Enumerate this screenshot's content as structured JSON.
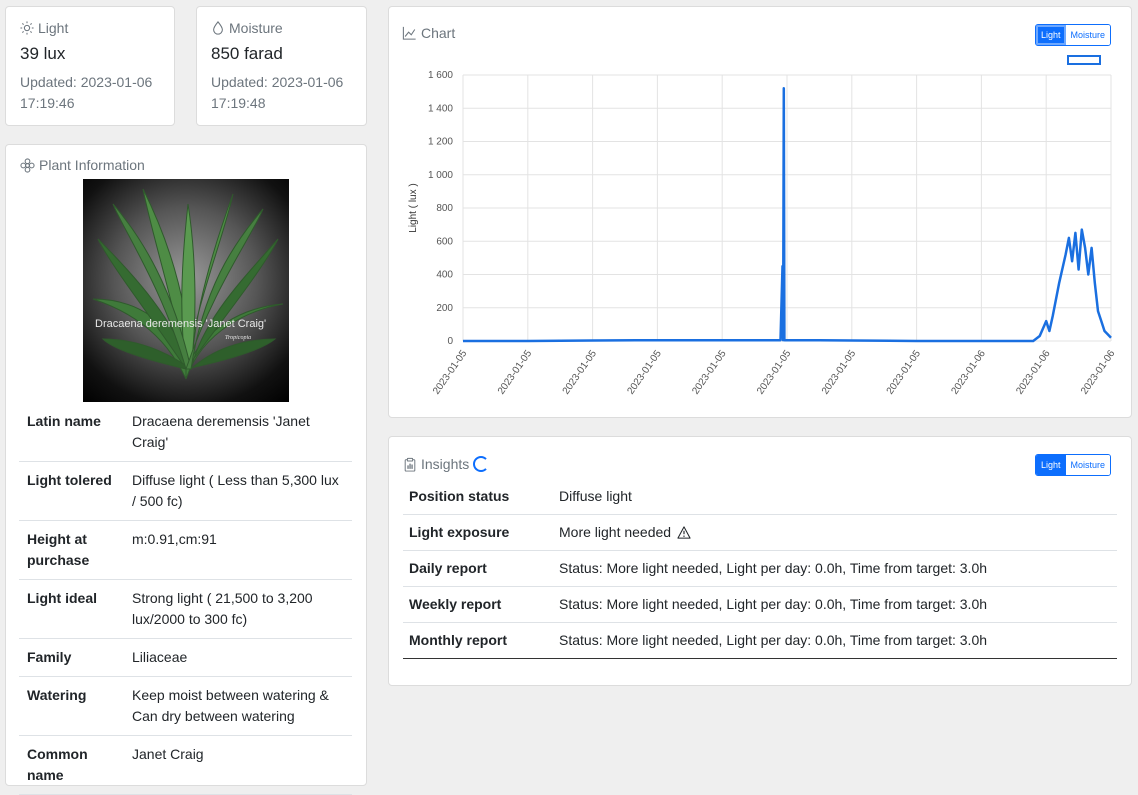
{
  "light_card": {
    "title": "Light",
    "value": "39 lux",
    "updated": "Updated: 2023-01-06 17:19:46"
  },
  "moisture_card": {
    "title": "Moisture",
    "value": "850 farad",
    "updated": "Updated: 2023-01-06 17:19:48"
  },
  "plant": {
    "title": "Plant Information",
    "photo_caption": "Dracaena deremensis 'Janet Craig'",
    "photo_watermark": "Tropicopia",
    "rows": [
      {
        "key": "Latin name",
        "value": "Dracaena deremensis 'Janet Craig'"
      },
      {
        "key": "Light tolered",
        "value": "Diffuse light ( Less than 5,300 lux / 500 fc)"
      },
      {
        "key": "Height at purchase",
        "value": "m:0.91,cm:91"
      },
      {
        "key": "Light ideal",
        "value": "Strong light ( 21,500 to 3,200 lux/2000 to 300 fc)"
      },
      {
        "key": "Family",
        "value": "Liliaceae"
      },
      {
        "key": "Watering",
        "value": "Keep moist between watering & Can dry between watering"
      },
      {
        "key": "Common name",
        "value": "Janet Craig"
      }
    ]
  },
  "chart_card": {
    "title": "Chart",
    "toggle": {
      "light": "Light",
      "moisture": "Moisture",
      "active": "light"
    }
  },
  "insights": {
    "title": "Insights",
    "toggle": {
      "light": "Light",
      "moisture": "Moisture",
      "active": "light"
    },
    "rows": [
      {
        "key": "Position status",
        "value": "Diffuse light"
      },
      {
        "key": "Light exposure",
        "value": "More light needed",
        "icon": "warning-icon"
      },
      {
        "key": "Daily report",
        "value": "Status: More light needed, Light per day: 0.0h, Time from target: 3.0h"
      },
      {
        "key": "Weekly report",
        "value": "Status: More light needed, Light per day: 0.0h, Time from target: 3.0h"
      },
      {
        "key": "Monthly report",
        "value": "Status: More light needed, Light per day: 0.0h, Time from target: 3.0h"
      }
    ]
  },
  "chart_data": {
    "type": "line",
    "ylabel": "Light ( lux )",
    "ylim": [
      0,
      1600
    ],
    "yticks": [
      "0",
      "200",
      "400",
      "600",
      "800",
      "1 000",
      "1 200",
      "1 400",
      "1 600"
    ],
    "yticks_values": [
      0,
      200,
      400,
      600,
      800,
      1000,
      1200,
      1400,
      1600
    ],
    "xticks": [
      "2023-01-05",
      "2023-01-05",
      "2023-01-05",
      "2023-01-05",
      "2023-01-05",
      "2023-01-05",
      "2023-01-05",
      "2023-01-05",
      "2023-01-06",
      "2023-01-06",
      "2023-01-06"
    ],
    "grid": true,
    "series": [
      {
        "color": "#1a6fe0",
        "x": [
          0,
          0.1,
          0.2,
          0.3,
          0.4,
          0.45,
          0.49,
          0.493,
          0.494,
          0.495,
          0.496,
          0.497,
          0.498,
          0.5,
          0.55,
          0.6,
          0.7,
          0.8,
          0.88,
          0.89,
          0.9,
          0.905,
          0.91,
          0.92,
          0.93,
          0.935,
          0.94,
          0.945,
          0.95,
          0.955,
          0.96,
          0.965,
          0.97,
          0.975,
          0.98,
          0.985,
          0.99,
          0.995,
          1.0
        ],
        "values": [
          0,
          0,
          3,
          5,
          5,
          5,
          5,
          450,
          5,
          1520,
          5,
          5,
          5,
          5,
          5,
          3,
          0,
          0,
          0,
          30,
          120,
          60,
          150,
          350,
          520,
          620,
          480,
          650,
          430,
          670,
          560,
          400,
          560,
          350,
          180,
          120,
          60,
          40,
          20
        ]
      }
    ]
  }
}
